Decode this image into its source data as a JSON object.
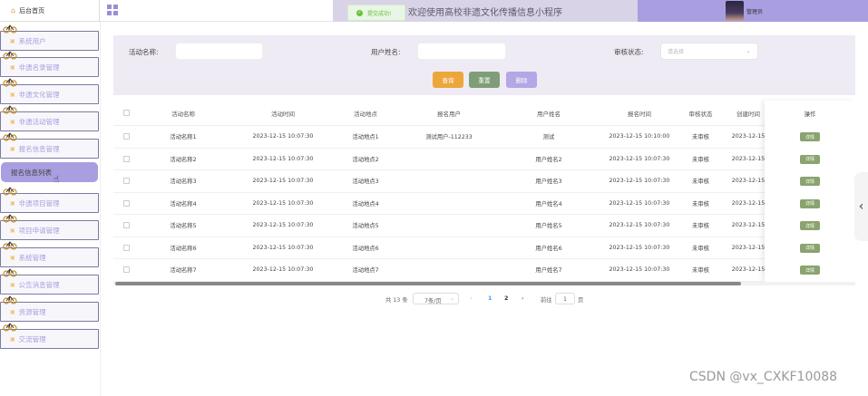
{
  "header": {
    "home_label": "后台首页",
    "title": "欢迎使用高校非遗文化传播信息小程序",
    "user_name": "管理员",
    "toast": "提交成功!",
    "accent_color": "#a89ee0"
  },
  "sidebar": {
    "items": [
      {
        "label": "系统用户",
        "icon": "user-icon"
      },
      {
        "label": "非遗名录管理",
        "icon": "list-icon"
      },
      {
        "label": "非遗文化管理",
        "icon": "list-icon"
      },
      {
        "label": "非遗活动管理",
        "icon": "list-icon"
      },
      {
        "label": "报名信息管理",
        "icon": "list-icon"
      },
      {
        "label": "报名信息列表",
        "icon": ""
      },
      {
        "label": "非遗项目管理",
        "icon": "list-icon"
      },
      {
        "label": "项目申请管理",
        "icon": "list-icon"
      },
      {
        "label": "系统管理",
        "icon": "list-icon"
      },
      {
        "label": "公告消息管理",
        "icon": "list-icon"
      },
      {
        "label": "资源管理",
        "icon": "list-icon"
      },
      {
        "label": "交流管理",
        "icon": "list-icon"
      }
    ]
  },
  "filter": {
    "activity_name_label": "活动名称:",
    "user_name_label": "用户姓名:",
    "status_label": "审核状态:",
    "status_placeholder": "请选择",
    "query_btn": "查询",
    "reset_btn": "重置",
    "delete_btn": "删除"
  },
  "table": {
    "headers": [
      "活动名称",
      "活动时间",
      "活动地点",
      "报名用户",
      "用户姓名",
      "报名时间",
      "审核状态",
      "创建时间",
      "操作"
    ],
    "detail_label": "详情",
    "rows": [
      [
        "活动名称1",
        "2023-12-15 10:07:30",
        "活动地点1",
        "测试用户-112233",
        "测试",
        "2023-12-15 10:10:00",
        "未审核",
        "2023-12-15"
      ],
      [
        "活动名称2",
        "2023-12-15 10:07:30",
        "活动地点2",
        "",
        "用户姓名2",
        "2023-12-15 10:07:30",
        "未审核",
        "2023-12-15"
      ],
      [
        "活动名称3",
        "2023-12-15 10:07:30",
        "活动地点3",
        "",
        "用户姓名3",
        "2023-12-15 10:07:30",
        "未审核",
        "2023-12-15"
      ],
      [
        "活动名称4",
        "2023-12-15 10:07:30",
        "活动地点4",
        "",
        "用户姓名4",
        "2023-12-15 10:07:30",
        "未审核",
        "2023-12-15"
      ],
      [
        "活动名称5",
        "2023-12-15 10:07:30",
        "活动地点5",
        "",
        "用户姓名5",
        "2023-12-15 10:07:30",
        "未审核",
        "2023-12-15"
      ],
      [
        "活动名称6",
        "2023-12-15 10:07:30",
        "活动地点6",
        "",
        "用户姓名6",
        "2023-12-15 10:07:30",
        "未审核",
        "2023-12-15"
      ],
      [
        "活动名称7",
        "2023-12-15 10:07:30",
        "活动地点7",
        "",
        "用户姓名7",
        "2023-12-15 10:07:30",
        "未审核",
        "2023-12-15"
      ]
    ]
  },
  "pagination": {
    "total": "共 13 条",
    "page_size": "7条/页",
    "prev": "‹",
    "pages": [
      "1",
      "2"
    ],
    "next": "›",
    "goto_label": "前往",
    "goto_value": "1",
    "page_suffix": "页"
  },
  "watermark": "CSDN @vx_CXKF10088"
}
